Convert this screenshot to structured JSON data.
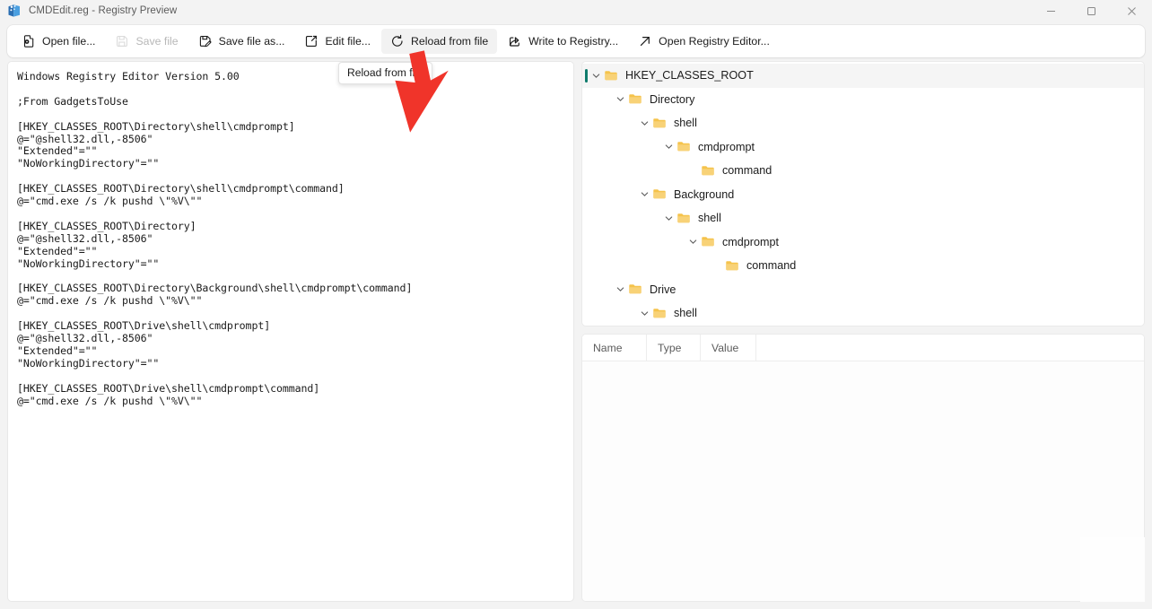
{
  "window": {
    "title": "CMDEdit.reg - Registry Preview",
    "app_icon": "registry-preview-icon",
    "controls": {
      "minimize": "minimize-icon",
      "maximize": "maximize-icon",
      "close": "close-icon"
    }
  },
  "toolbar": {
    "buttons": [
      {
        "label": "Open file...",
        "icon": "open-file-icon",
        "state": "enabled"
      },
      {
        "label": "Save file",
        "icon": "save-file-icon",
        "state": "disabled"
      },
      {
        "label": "Save file as...",
        "icon": "save-file-as-icon",
        "state": "enabled"
      },
      {
        "label": "Edit file...",
        "icon": "edit-file-icon",
        "state": "enabled"
      },
      {
        "label": "Reload from file",
        "icon": "reload-icon",
        "state": "hovered"
      },
      {
        "label": "Write to Registry...",
        "icon": "write-to-registry-icon",
        "state": "enabled"
      },
      {
        "label": "Open Registry Editor...",
        "icon": "open-registry-editor-icon",
        "state": "enabled"
      }
    ]
  },
  "tooltip": {
    "text": "Reload from file"
  },
  "editor": {
    "content": "Windows Registry Editor Version 5.00\n\n;From GadgetsToUse\n\n[HKEY_CLASSES_ROOT\\Directory\\shell\\cmdprompt]\n@=\"@shell32.dll,-8506\"\n\"Extended\"=\"\"\n\"NoWorkingDirectory\"=\"\"\n\n[HKEY_CLASSES_ROOT\\Directory\\shell\\cmdprompt\\command]\n@=\"cmd.exe /s /k pushd \\\"%V\\\"\"\n\n[HKEY_CLASSES_ROOT\\Directory]\n@=\"@shell32.dll,-8506\"\n\"Extended\"=\"\"\n\"NoWorkingDirectory\"=\"\"\n\n[HKEY_CLASSES_ROOT\\Directory\\Background\\shell\\cmdprompt\\command]\n@=\"cmd.exe /s /k pushd \\\"%V\\\"\"\n\n[HKEY_CLASSES_ROOT\\Drive\\shell\\cmdprompt]\n@=\"@shell32.dll,-8506\"\n\"Extended\"=\"\"\n\"NoWorkingDirectory\"=\"\"\n\n[HKEY_CLASSES_ROOT\\Drive\\shell\\cmdprompt\\command]\n@=\"cmd.exe /s /k pushd \\\"%V\\\"\""
  },
  "tree": {
    "nodes": [
      {
        "label": "HKEY_CLASSES_ROOT",
        "depth": 0,
        "expanded": true,
        "selected": true
      },
      {
        "label": "Directory",
        "depth": 1,
        "expanded": true,
        "selected": false
      },
      {
        "label": "shell",
        "depth": 2,
        "expanded": true,
        "selected": false
      },
      {
        "label": "cmdprompt",
        "depth": 3,
        "expanded": true,
        "selected": false
      },
      {
        "label": "command",
        "depth": 4,
        "expanded": false,
        "selected": false
      },
      {
        "label": "Background",
        "depth": 2,
        "expanded": true,
        "selected": false
      },
      {
        "label": "shell",
        "depth": 3,
        "expanded": true,
        "selected": false
      },
      {
        "label": "cmdprompt",
        "depth": 4,
        "expanded": true,
        "selected": false
      },
      {
        "label": "command",
        "depth": 5,
        "expanded": false,
        "selected": false
      },
      {
        "label": "Drive",
        "depth": 1,
        "expanded": true,
        "selected": false
      },
      {
        "label": "shell",
        "depth": 2,
        "expanded": true,
        "selected": false
      }
    ],
    "selection_accent": "#0f7b6c",
    "folder_color": "#f5c34b"
  },
  "values_table": {
    "columns": [
      "Name",
      "Type",
      "Value"
    ],
    "rows": []
  }
}
